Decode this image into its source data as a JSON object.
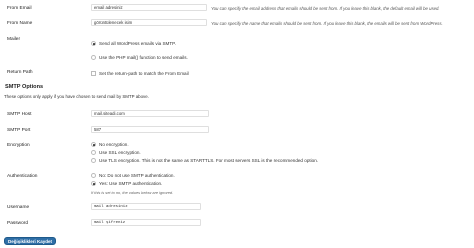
{
  "from_email": {
    "label": "From Email",
    "value": "email adresiniz",
    "description": "You can specify the email address that emails should be sent from. If you leave this blank, the default email will be used."
  },
  "from_name": {
    "label": "From Name",
    "value": "görüntülenecek isim",
    "description": "You can specify the name that emails should be sent from. If you leave this blank, the emails will be sent from WordPress."
  },
  "mailer": {
    "label": "Mailer",
    "options": [
      {
        "label": "Send all WordPress emails via SMTP.",
        "selected": true
      },
      {
        "label": "Use the PHP mail() function to send emails.",
        "selected": false
      }
    ]
  },
  "return_path": {
    "label": "Return Path",
    "checkbox_label": "Set the return-path to match the From Email",
    "checked": false
  },
  "smtp_options": {
    "heading": "SMTP Options",
    "note": "These options only apply if you have chosen to send mail by SMTP above."
  },
  "smtp_host": {
    "label": "SMTP Host",
    "value": "mail.siteadi.com"
  },
  "smtp_port": {
    "label": "SMTP Port",
    "value": "587"
  },
  "encryption": {
    "label": "Encryption",
    "options": [
      {
        "label": "No encryption.",
        "selected": true
      },
      {
        "label": "Use SSL encryption.",
        "selected": false
      },
      {
        "label": "Use TLS encryption. This is not the same as STARTTLS. For most servers SSL is the recommended option.",
        "selected": false
      }
    ]
  },
  "authentication": {
    "label": "Authentication",
    "options": [
      {
        "label": "No: Do not use SMTP authentication.",
        "selected": false
      },
      {
        "label": "Yes: Use SMTP authentication.",
        "selected": true
      }
    ],
    "note": "If this is set to no, the values below are ignored."
  },
  "username": {
    "label": "Username",
    "value": "mail adresiniz"
  },
  "password": {
    "label": "Password",
    "value": "mail şifreniz"
  },
  "submit": {
    "label": "Değişiklikleri Kaydet"
  }
}
